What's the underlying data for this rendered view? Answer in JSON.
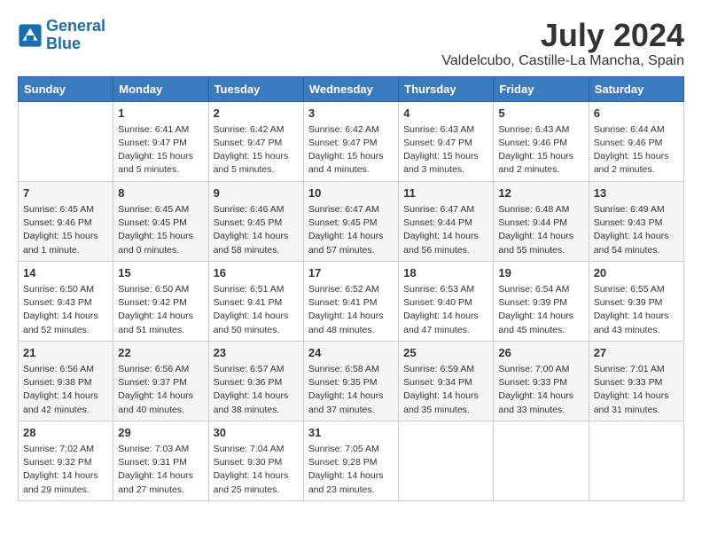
{
  "header": {
    "logo_line1": "General",
    "logo_line2": "Blue",
    "title": "July 2024",
    "subtitle": "Valdelcubo, Castille-La Mancha, Spain"
  },
  "days_of_week": [
    "Sunday",
    "Monday",
    "Tuesday",
    "Wednesday",
    "Thursday",
    "Friday",
    "Saturday"
  ],
  "weeks": [
    [
      {
        "day": "",
        "content": ""
      },
      {
        "day": "1",
        "content": "Sunrise: 6:41 AM\nSunset: 9:47 PM\nDaylight: 15 hours\nand 5 minutes."
      },
      {
        "day": "2",
        "content": "Sunrise: 6:42 AM\nSunset: 9:47 PM\nDaylight: 15 hours\nand 5 minutes."
      },
      {
        "day": "3",
        "content": "Sunrise: 6:42 AM\nSunset: 9:47 PM\nDaylight: 15 hours\nand 4 minutes."
      },
      {
        "day": "4",
        "content": "Sunrise: 6:43 AM\nSunset: 9:47 PM\nDaylight: 15 hours\nand 3 minutes."
      },
      {
        "day": "5",
        "content": "Sunrise: 6:43 AM\nSunset: 9:46 PM\nDaylight: 15 hours\nand 2 minutes."
      },
      {
        "day": "6",
        "content": "Sunrise: 6:44 AM\nSunset: 9:46 PM\nDaylight: 15 hours\nand 2 minutes."
      }
    ],
    [
      {
        "day": "7",
        "content": "Sunrise: 6:45 AM\nSunset: 9:46 PM\nDaylight: 15 hours\nand 1 minute."
      },
      {
        "day": "8",
        "content": "Sunrise: 6:45 AM\nSunset: 9:45 PM\nDaylight: 15 hours\nand 0 minutes."
      },
      {
        "day": "9",
        "content": "Sunrise: 6:46 AM\nSunset: 9:45 PM\nDaylight: 14 hours\nand 58 minutes."
      },
      {
        "day": "10",
        "content": "Sunrise: 6:47 AM\nSunset: 9:45 PM\nDaylight: 14 hours\nand 57 minutes."
      },
      {
        "day": "11",
        "content": "Sunrise: 6:47 AM\nSunset: 9:44 PM\nDaylight: 14 hours\nand 56 minutes."
      },
      {
        "day": "12",
        "content": "Sunrise: 6:48 AM\nSunset: 9:44 PM\nDaylight: 14 hours\nand 55 minutes."
      },
      {
        "day": "13",
        "content": "Sunrise: 6:49 AM\nSunset: 9:43 PM\nDaylight: 14 hours\nand 54 minutes."
      }
    ],
    [
      {
        "day": "14",
        "content": "Sunrise: 6:50 AM\nSunset: 9:43 PM\nDaylight: 14 hours\nand 52 minutes."
      },
      {
        "day": "15",
        "content": "Sunrise: 6:50 AM\nSunset: 9:42 PM\nDaylight: 14 hours\nand 51 minutes."
      },
      {
        "day": "16",
        "content": "Sunrise: 6:51 AM\nSunset: 9:41 PM\nDaylight: 14 hours\nand 50 minutes."
      },
      {
        "day": "17",
        "content": "Sunrise: 6:52 AM\nSunset: 9:41 PM\nDaylight: 14 hours\nand 48 minutes."
      },
      {
        "day": "18",
        "content": "Sunrise: 6:53 AM\nSunset: 9:40 PM\nDaylight: 14 hours\nand 47 minutes."
      },
      {
        "day": "19",
        "content": "Sunrise: 6:54 AM\nSunset: 9:39 PM\nDaylight: 14 hours\nand 45 minutes."
      },
      {
        "day": "20",
        "content": "Sunrise: 6:55 AM\nSunset: 9:39 PM\nDaylight: 14 hours\nand 43 minutes."
      }
    ],
    [
      {
        "day": "21",
        "content": "Sunrise: 6:56 AM\nSunset: 9:38 PM\nDaylight: 14 hours\nand 42 minutes."
      },
      {
        "day": "22",
        "content": "Sunrise: 6:56 AM\nSunset: 9:37 PM\nDaylight: 14 hours\nand 40 minutes."
      },
      {
        "day": "23",
        "content": "Sunrise: 6:57 AM\nSunset: 9:36 PM\nDaylight: 14 hours\nand 38 minutes."
      },
      {
        "day": "24",
        "content": "Sunrise: 6:58 AM\nSunset: 9:35 PM\nDaylight: 14 hours\nand 37 minutes."
      },
      {
        "day": "25",
        "content": "Sunrise: 6:59 AM\nSunset: 9:34 PM\nDaylight: 14 hours\nand 35 minutes."
      },
      {
        "day": "26",
        "content": "Sunrise: 7:00 AM\nSunset: 9:33 PM\nDaylight: 14 hours\nand 33 minutes."
      },
      {
        "day": "27",
        "content": "Sunrise: 7:01 AM\nSunset: 9:33 PM\nDaylight: 14 hours\nand 31 minutes."
      }
    ],
    [
      {
        "day": "28",
        "content": "Sunrise: 7:02 AM\nSunset: 9:32 PM\nDaylight: 14 hours\nand 29 minutes."
      },
      {
        "day": "29",
        "content": "Sunrise: 7:03 AM\nSunset: 9:31 PM\nDaylight: 14 hours\nand 27 minutes."
      },
      {
        "day": "30",
        "content": "Sunrise: 7:04 AM\nSunset: 9:30 PM\nDaylight: 14 hours\nand 25 minutes."
      },
      {
        "day": "31",
        "content": "Sunrise: 7:05 AM\nSunset: 9:28 PM\nDaylight: 14 hours\nand 23 minutes."
      },
      {
        "day": "",
        "content": ""
      },
      {
        "day": "",
        "content": ""
      },
      {
        "day": "",
        "content": ""
      }
    ]
  ]
}
